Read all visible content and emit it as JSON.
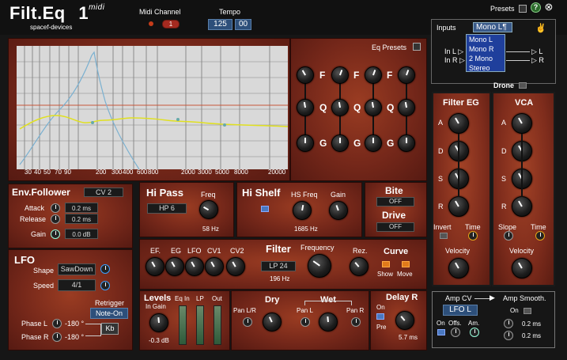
{
  "header": {
    "title": "Filt.Eq",
    "title_num": "1",
    "title_sup": "midi",
    "brand": "spacef-devices",
    "midi_channel_label": "Midi Channel",
    "midi_channel_value": "1",
    "tempo_label": "Tempo",
    "tempo_value": "125",
    "tempo_fraction": "00",
    "presets_label": "Presets",
    "help": "?",
    "close": "⊗"
  },
  "eq": {
    "presets_label": "Eq Presets",
    "freq_ticks": [
      "30",
      "40",
      "50",
      "70",
      "90",
      "200",
      "300",
      "400",
      "600",
      "800",
      "2000",
      "3000",
      "5000",
      "8000",
      "20000"
    ],
    "grid_f": "F",
    "grid_q": "Q",
    "grid_g": "G"
  },
  "inputs": {
    "label": "Inputs",
    "selected": "Mono L¶",
    "options": [
      "Mono L",
      "Mono R",
      "2 Mono",
      "Stereo"
    ],
    "in_l": "In L",
    "in_r": "In R",
    "out_l": "L",
    "out_r": "R",
    "drone_label": "Drone"
  },
  "env_follower": {
    "title": "Env.Follower",
    "source": "CV 2",
    "attack_label": "Attack",
    "attack_value": "0.2 ms",
    "release_label": "Release",
    "release_value": "0.2 ms",
    "gain_label": "Gain",
    "gain_value": "0.0 dB"
  },
  "lfo": {
    "title": "LFO",
    "shape_label": "Shape",
    "shape_value": "SawDown",
    "speed_label": "Speed",
    "speed_value": "4/1",
    "retrigger_label": "Retrigger",
    "retrigger_value": "Note-On",
    "phase_l_label": "Phase L",
    "phase_l_value": "-180 °",
    "phase_r_label": "Phase R",
    "phase_r_value": "-180 °",
    "kb": "Kb"
  },
  "hi_pass": {
    "title": "Hi Pass",
    "type": "HP 6",
    "freq_label": "Freq",
    "freq_value": "58 Hz"
  },
  "hi_shelf": {
    "title": "Hi Shelf",
    "freq_label": "HS Freq",
    "freq_value": "1685 Hz",
    "gain_label": "Gain"
  },
  "bite": {
    "title": "Bite",
    "value": "OFF"
  },
  "drive": {
    "title": "Drive",
    "value": "OFF"
  },
  "filter": {
    "title": "Filter",
    "mod_labels": [
      "EF.",
      "EG",
      "LFO",
      "CV1",
      "CV2"
    ],
    "type": "LP 24",
    "freq_label": "Frequency",
    "freq_value": "196 Hz",
    "rez_label": "Rez.",
    "curve_label": "Curve",
    "show_label": "Show",
    "move_label": "Move"
  },
  "levels": {
    "title": "Levels",
    "in_gain_label": "In Gain",
    "in_gain_value": "-0.3 dB",
    "eq_in_label": "Eq In",
    "lp_label": "LP",
    "out_label": "Out"
  },
  "dry": {
    "title": "Dry",
    "pan_label": "Pan L/R"
  },
  "wet": {
    "title": "Wet",
    "pan_l_label": "Pan L",
    "pan_r_label": "Pan R"
  },
  "delay_r": {
    "title": "Delay R",
    "on_label": "On",
    "pre_label": "Pre",
    "value": "5.7 ms"
  },
  "filter_eg": {
    "title": "Filter EG",
    "a": "A",
    "d": "D",
    "s": "S",
    "r": "R",
    "invert_label": "Invert",
    "time_label": "Time",
    "velocity_label": "Velocity"
  },
  "vca": {
    "title": "VCA",
    "a": "A",
    "d": "D",
    "s": "S",
    "r": "R",
    "slope_label": "Slope",
    "time_label": "Time",
    "velocity_label": "Velocity"
  },
  "amp_cv": {
    "title": "Amp CV",
    "source": "LFO L",
    "on_label": "On",
    "offs_label": "Offs.",
    "am_label": "Am."
  },
  "amp_smooth": {
    "title": "Amp Smooth.",
    "on_label": "On",
    "value1": "0.2 ms",
    "value2": "0.2 ms"
  }
}
